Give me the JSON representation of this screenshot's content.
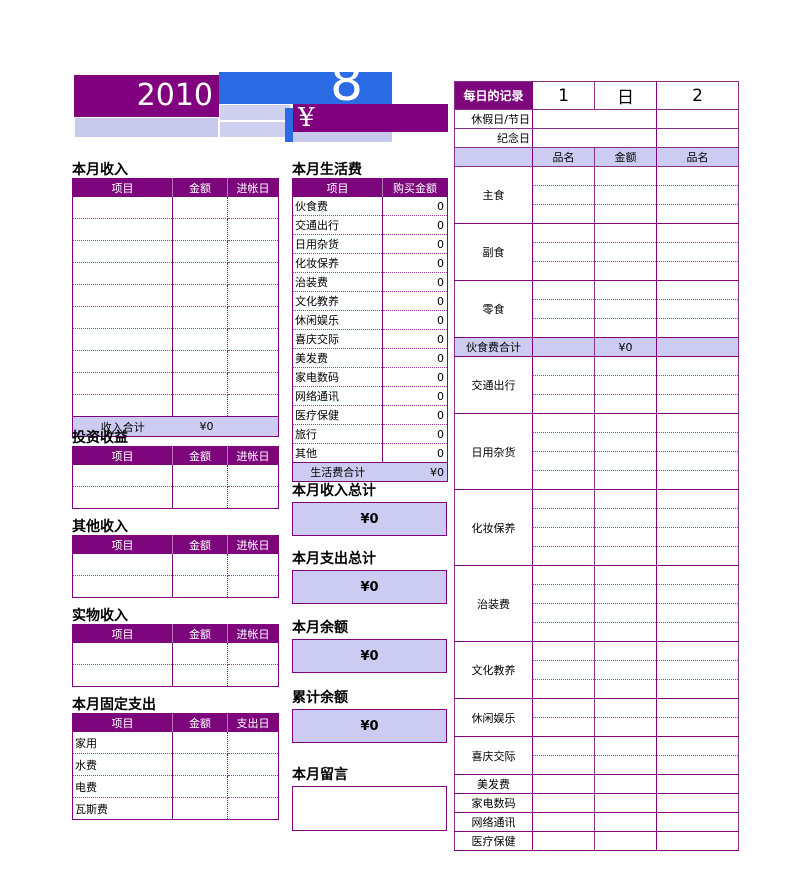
{
  "banner": {
    "year": "2010",
    "month_glyph": "8",
    "currency_symbol": "¥"
  },
  "left": {
    "income": {
      "title": "本月收入",
      "headers": [
        "项目",
        "金额",
        "进帐日"
      ],
      "rows": 10,
      "total_label": "收入合计",
      "total_value": "¥0"
    },
    "investment": {
      "title": "投资收益",
      "headers": [
        "项目",
        "金额",
        "进帐日"
      ],
      "rows": 2
    },
    "other_income": {
      "title": "其他收入",
      "headers": [
        "项目",
        "金额",
        "进帐日"
      ],
      "rows": 2
    },
    "goods_income": {
      "title": "实物收入",
      "headers": [
        "项目",
        "金额",
        "进帐日"
      ],
      "rows": 2
    },
    "fixed_expense": {
      "title": "本月固定支出",
      "headers": [
        "项目",
        "金额",
        "支出日"
      ],
      "items": [
        "家用",
        "水费",
        "电费",
        "瓦斯费"
      ]
    }
  },
  "middle": {
    "living": {
      "title": "本月生活费",
      "headers": [
        "项目",
        "购买金额"
      ],
      "items": [
        {
          "name": "伙食费",
          "amount": "0"
        },
        {
          "name": "交通出行",
          "amount": "0"
        },
        {
          "name": "日用杂货",
          "amount": "0"
        },
        {
          "name": "化妆保养",
          "amount": "0"
        },
        {
          "name": "治装费",
          "amount": "0"
        },
        {
          "name": "文化教养",
          "amount": "0"
        },
        {
          "name": "休闲娱乐",
          "amount": "0"
        },
        {
          "name": "喜庆交际",
          "amount": "0"
        },
        {
          "name": "美发费",
          "amount": "0"
        },
        {
          "name": "家电数码",
          "amount": "0"
        },
        {
          "name": "网络通讯",
          "amount": "0"
        },
        {
          "name": "医疗保健",
          "amount": "0"
        },
        {
          "name": "旅行",
          "amount": "0"
        },
        {
          "name": "其他",
          "amount": "0"
        }
      ],
      "total_label": "生活费合计",
      "total_value": "¥0"
    },
    "summaries": [
      {
        "title": "本月收入总计",
        "value": "¥0"
      },
      {
        "title": "本月支出总计",
        "value": "¥0"
      },
      {
        "title": "本月余额",
        "value": "¥0"
      },
      {
        "title": "累计余额",
        "value": "¥0"
      }
    ],
    "message": {
      "title": "本月留言",
      "value": ""
    }
  },
  "right": {
    "header": {
      "label": "每日的记录",
      "day1": "1",
      "weekday": "日",
      "day2": "2"
    },
    "holiday_label": "休假日/节日",
    "anniversary_label": "纪念日",
    "subheaders": [
      "品名",
      "金额",
      "品名"
    ],
    "groups": [
      {
        "label": "主食",
        "rows": 3
      },
      {
        "label": "副食",
        "rows": 3
      },
      {
        "label": "零食",
        "rows": 3
      },
      {
        "label": "伙食费合计",
        "rows": 1,
        "total": true,
        "value": "¥0"
      },
      {
        "label": "交通出行",
        "rows": 3
      },
      {
        "label": "日用杂货",
        "rows": 4
      },
      {
        "label": "化妆保养",
        "rows": 4
      },
      {
        "label": "治装费",
        "rows": 4
      },
      {
        "label": "文化教养",
        "rows": 3
      },
      {
        "label": "休闲娱乐",
        "rows": 2
      },
      {
        "label": "喜庆交际",
        "rows": 2
      },
      {
        "label": "美发费",
        "rows": 1
      },
      {
        "label": "家电数码",
        "rows": 1
      },
      {
        "label": "网络通讯",
        "rows": 1
      },
      {
        "label": "医疗保健",
        "rows": 1
      }
    ]
  },
  "colors": {
    "purple_dark": "#7D067D",
    "purple_border": "#800080",
    "lavender": "#CCCCF2",
    "blue_banner": "#2B6BE4"
  }
}
